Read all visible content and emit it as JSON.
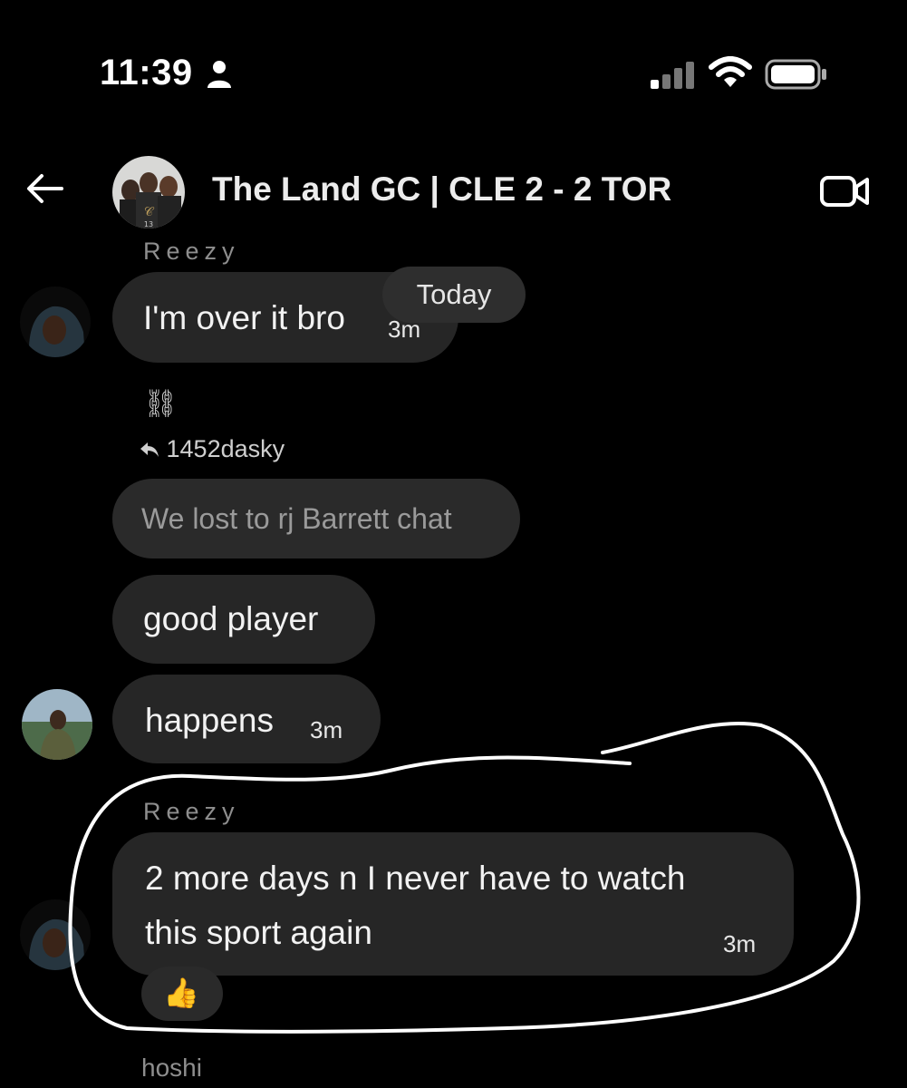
{
  "status_bar": {
    "time": "11:39",
    "icons": [
      "person-icon",
      "signal-icon",
      "wifi-icon",
      "battery-icon"
    ]
  },
  "header": {
    "title": "The Land GC | CLE 2 - 2 TOR",
    "back_icon": "back-arrow-icon",
    "video_icon": "video-call-icon"
  },
  "messages": {
    "m1": {
      "sender": "Reezy",
      "text": "I'm over it bro",
      "time": "3m"
    },
    "date_pill": "Today",
    "m2": {
      "emoji": "⛓",
      "reply_to": "1452dasky",
      "reply_text": "We lost to rj Barrett chat"
    },
    "m3": {
      "text": "good player"
    },
    "m4": {
      "text": "happens",
      "time": "3m"
    },
    "m5": {
      "sender": "Reezy",
      "line1": "2 more days n I never have to watch",
      "line2": "this sport again",
      "time": "3m",
      "reaction": "👍"
    },
    "next_sender": "hoshi"
  },
  "colors": {
    "background": "#000000",
    "bubble": "#262626",
    "reply_bubble": "#2a2a2a",
    "muted_text": "#8e8e8e",
    "annotation_stroke": "#ffffff"
  }
}
